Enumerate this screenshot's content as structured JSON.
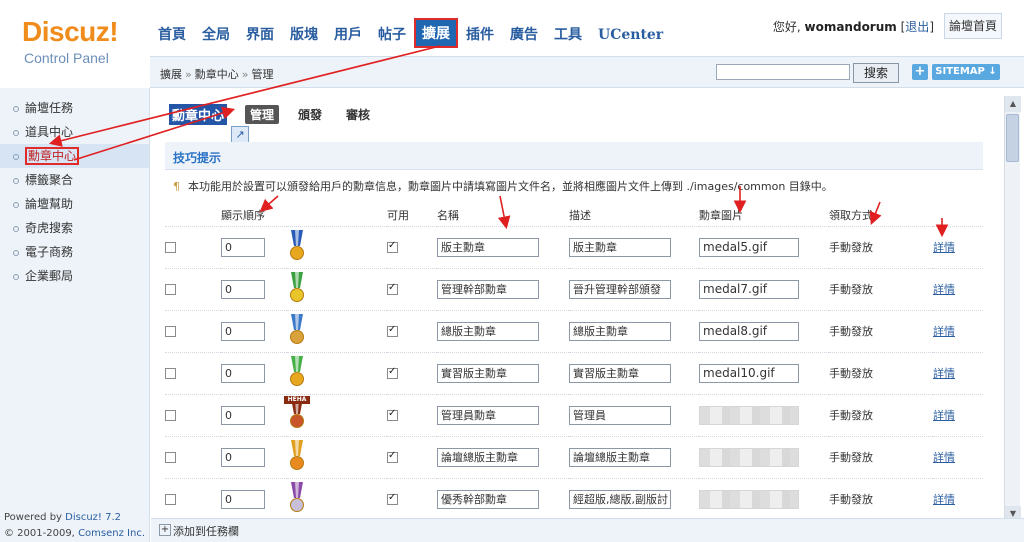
{
  "logo": {
    "brand": "Discuz!",
    "subtitle": "Control Panel"
  },
  "topnav": [
    {
      "label": "首頁",
      "active": false
    },
    {
      "label": "全局",
      "active": false
    },
    {
      "label": "界面",
      "active": false
    },
    {
      "label": "版塊",
      "active": false
    },
    {
      "label": "用戶",
      "active": false
    },
    {
      "label": "帖子",
      "active": false
    },
    {
      "label": "擴展",
      "active": true
    },
    {
      "label": "插件",
      "active": false
    },
    {
      "label": "廣告",
      "active": false
    },
    {
      "label": "工具",
      "active": false
    },
    {
      "label": "UCenter",
      "active": false
    }
  ],
  "user": {
    "greeting": "您好,",
    "name": "womandorum",
    "logout": "退出",
    "forum_home": "論壇首頁"
  },
  "breadcrumb": {
    "part1": "擴展",
    "part2": "勳章中心",
    "part3": "管理"
  },
  "search": {
    "button": "搜索",
    "plus": "+",
    "sitemap": "SITEMAP ↓"
  },
  "sidebar": {
    "items": [
      {
        "label": "論壇任務"
      },
      {
        "label": "道具中心"
      },
      {
        "label": "勳章中心",
        "active": true
      },
      {
        "label": "標籤聚合"
      },
      {
        "label": "論壇幫助"
      },
      {
        "label": "奇虎搜索"
      },
      {
        "label": "電子商務"
      },
      {
        "label": "企業郵局"
      }
    ],
    "powered_prefix": "Powered by",
    "powered_brand": "Discuz! 7.2",
    "copyright_prefix": "© 2001-2009,",
    "copyright_brand": "Comsenz Inc."
  },
  "page": {
    "title": "勳章中心",
    "tabs": [
      {
        "label": "管理",
        "active": true
      },
      {
        "label": "頒發"
      },
      {
        "label": "審核"
      }
    ],
    "tips_heading": "技巧提示",
    "tips_text": "本功能用於設置可以頒發給用戶的勳章信息，勳章圖片中請填寫圖片文件名，並將相應圖片文件上傳到 ./images/common 目錄中。"
  },
  "table": {
    "headers": {
      "order": "顯示順序",
      "enabled": "可用",
      "name": "名稱",
      "desc": "描述",
      "image": "勳章圖片",
      "method": "領取方式"
    },
    "rows": [
      {
        "order": "0",
        "name": "版主勳章",
        "desc": "版主勳章",
        "image": "medal5.gif",
        "method": "手動發放",
        "detail": "詳情",
        "medal_color": "#e7a820",
        "ribbon": "#2b5bb8"
      },
      {
        "order": "0",
        "name": "管理幹部勳章",
        "desc": "晉升管理幹部頒發",
        "image": "medal7.gif",
        "method": "手動發放",
        "detail": "詳情",
        "medal_color": "#e8c52a",
        "ribbon": "#3aa040"
      },
      {
        "order": "0",
        "name": "總版主勳章",
        "desc": "總版主勳章",
        "image": "medal8.gif",
        "method": "手動發放",
        "detail": "詳情",
        "medal_color": "#d9a23a",
        "ribbon": "#3d79c9"
      },
      {
        "order": "0",
        "name": "實習版主勳章",
        "desc": "實習版主勳章",
        "image": "medal10.gif",
        "method": "手動發放",
        "detail": "詳情",
        "medal_color": "#e7a820",
        "ribbon": "#48b048"
      },
      {
        "order": "0",
        "name": "管理員勳章",
        "desc": "管理員",
        "image": "",
        "method": "手動發放",
        "detail": "詳情",
        "medal_color": "#c8562a",
        "ribbon": "#8a2a10",
        "hehe": "HEHA"
      },
      {
        "order": "0",
        "name": "論壇總版主勳章",
        "desc": "論壇總版主勳章",
        "image": "",
        "method": "手動發放",
        "detail": "詳情",
        "medal_color": "#e88a20",
        "ribbon": "#e0a020"
      },
      {
        "order": "0",
        "name": "優秀幹部勳章",
        "desc": "經超版,總版,副版討",
        "image": "",
        "method": "手動發放",
        "detail": "詳情",
        "medal_color": "#c8c0d8",
        "ribbon": "#8a4aa8"
      }
    ]
  },
  "footer": {
    "label": "添加到任務欄"
  }
}
